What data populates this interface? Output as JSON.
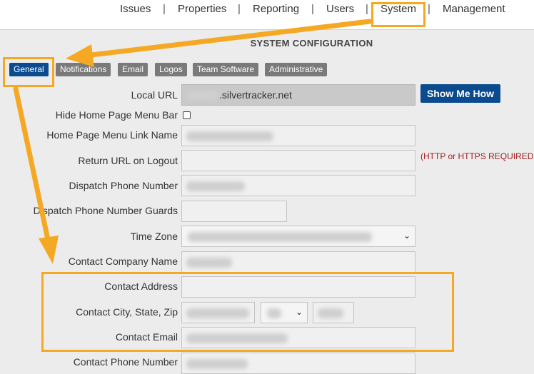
{
  "nav": {
    "items": [
      "Issues",
      "Properties",
      "Reporting",
      "Users",
      "System",
      "Management"
    ],
    "separator": "|"
  },
  "title": "SYSTEM CONFIGURATION",
  "tabs": [
    "General",
    "Notifications",
    "Email",
    "Logos",
    "Team Software",
    "Administrative"
  ],
  "active_tab": "General",
  "form": {
    "local_url_label": "Local URL",
    "local_url_suffix": ".silvertracker.net",
    "show_me_how": "Show Me How",
    "hide_menu_bar_label": "Hide Home Page Menu Bar",
    "menu_link_name_label": "Home Page Menu Link Name",
    "return_url_label": "Return URL on Logout",
    "return_url_note": "(HTTP or HTTPS REQUIRED!)",
    "dispatch_phone_label": "Dispatch Phone Number",
    "dispatch_phone_guards_label": "Dispatch Phone Number Guards",
    "time_zone_label": "Time Zone",
    "company_name_label": "Contact Company Name",
    "address_label": "Contact Address",
    "city_state_zip_label": "Contact City, State, Zip",
    "email_label": "Contact Email",
    "phone_label": "Contact Phone Number"
  },
  "colors": {
    "accent": "#0a4b8f",
    "highlight": "#f4a823",
    "note": "#a12020"
  }
}
